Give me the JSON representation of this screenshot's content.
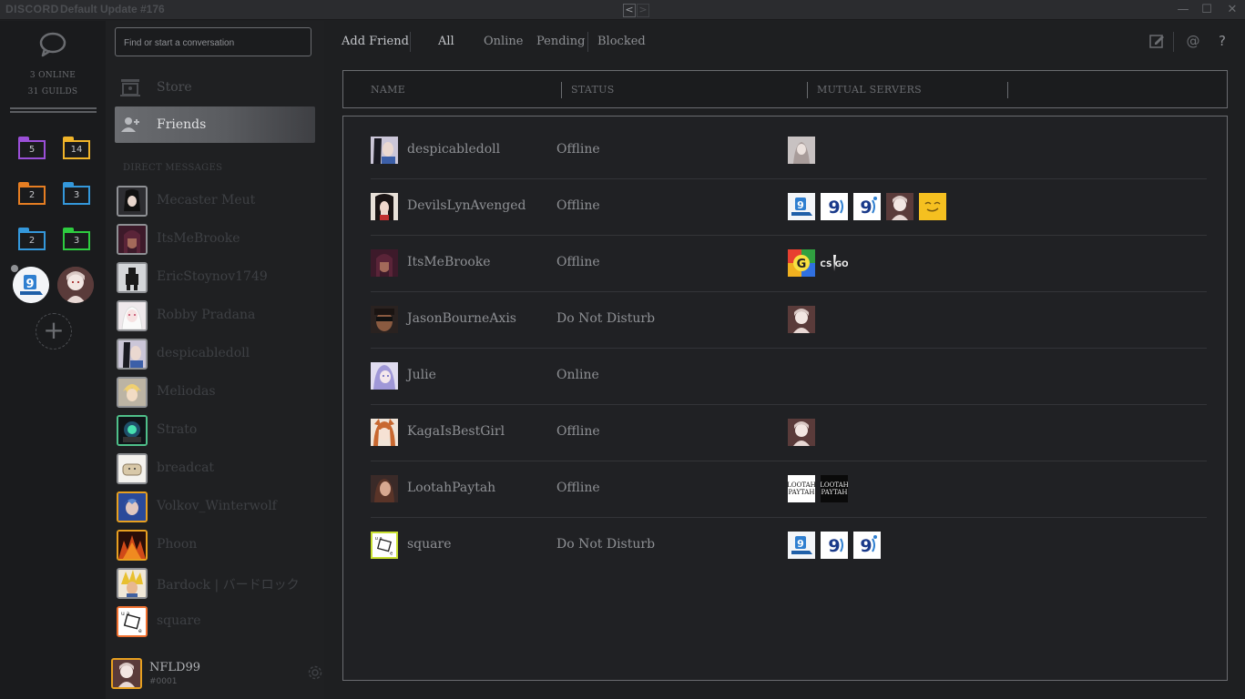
{
  "titlebar": {
    "logo": "DISCORD",
    "title": "Default Update #176",
    "back": "<",
    "forward": ">",
    "minimize": "—",
    "maximize": "☐",
    "close": "✕"
  },
  "guilds": {
    "online_text": "3 ONLINE",
    "guilds_text": "31 GUILDS",
    "folders": [
      {
        "count": "5",
        "color": "#9b4fd8"
      },
      {
        "count": "14",
        "color": "#f0b429"
      },
      {
        "count": "2",
        "color": "#e67e22"
      },
      {
        "count": "3",
        "color": "#3498db"
      },
      {
        "count": "2",
        "color": "#3498db"
      },
      {
        "count": "3",
        "color": "#2ecc40"
      }
    ],
    "add_label": "+"
  },
  "channels": {
    "search_placeholder": "Find or start a conversation",
    "store_label": "Store",
    "friends_label": "Friends",
    "dm_header": "DIRECT MESSAGES",
    "dms": [
      {
        "name": "Mecaster Meut"
      },
      {
        "name": "ItsMeBrooke"
      },
      {
        "name": "EricStoynov1749"
      },
      {
        "name": "Robby Pradana"
      },
      {
        "name": "despicabledoll"
      },
      {
        "name": "Meliodas"
      },
      {
        "name": "Strato"
      },
      {
        "name": "breadcat"
      },
      {
        "name": "Volkov_Winterwolf"
      },
      {
        "name": "Phoon"
      },
      {
        "name": "Bardock | バードロック"
      },
      {
        "name": "square"
      }
    ],
    "user": {
      "name": "NFLD99",
      "tag": "#0001"
    }
  },
  "toolbar": {
    "add_friend": "Add Friend",
    "all": "All",
    "online": "Online",
    "pending": "Pending",
    "blocked": "Blocked",
    "help": "?",
    "mention": "@"
  },
  "table": {
    "col_name": "NAME",
    "col_status": "STATUS",
    "col_mutual": "MUTUAL SERVERS"
  },
  "friends": [
    {
      "name": "despicabledoll",
      "status": "Offline",
      "servers": 1
    },
    {
      "name": "DevilsLynAvenged",
      "status": "Offline",
      "servers": 5
    },
    {
      "name": "ItsMeBrooke",
      "status": "Offline",
      "servers": 2
    },
    {
      "name": "JasonBourneAxis",
      "status": "Do Not Disturb",
      "servers": 1
    },
    {
      "name": "Julie",
      "status": "Online",
      "servers": 0
    },
    {
      "name": "KagaIsBestGirl",
      "status": "Offline",
      "servers": 1
    },
    {
      "name": "LootahPaytah",
      "status": "Offline",
      "servers": 2
    },
    {
      "name": "square",
      "status": "Do Not Disturb",
      "servers": 3
    }
  ]
}
